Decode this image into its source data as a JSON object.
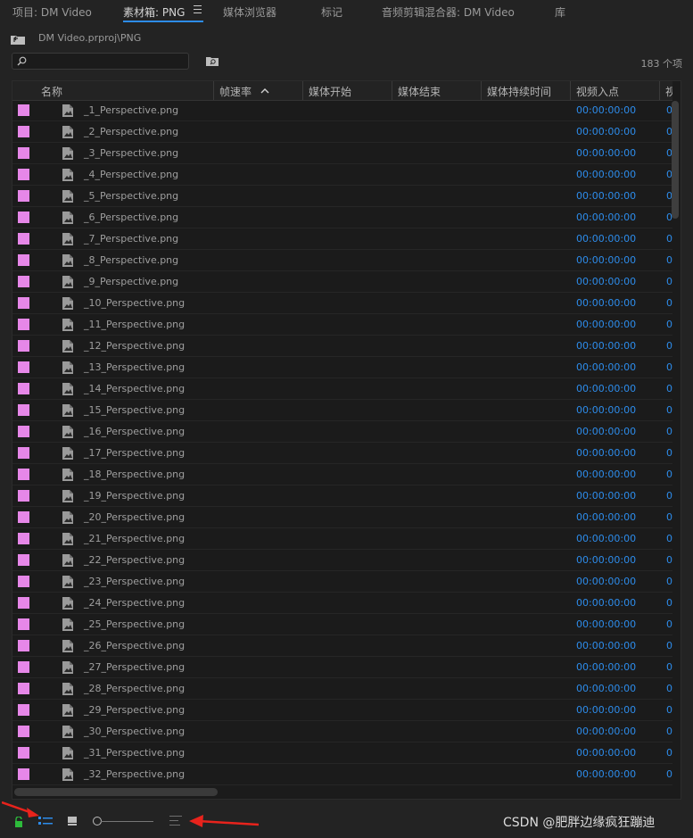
{
  "tabs": [
    {
      "label": "项目: DM Video"
    },
    {
      "label": "素材箱: PNG"
    },
    {
      "label": "媒体浏览器"
    },
    {
      "label": "标记"
    },
    {
      "label": "音频剪辑混合器: DM Video"
    },
    {
      "label": "库"
    }
  ],
  "path": "DM Video.prproj\\PNG",
  "search": {
    "placeholder": ""
  },
  "item_count": "183 个项",
  "columns": [
    "名称",
    "帧速率",
    "媒体开始",
    "媒体结束",
    "媒体持续时间",
    "视频入点",
    "视频"
  ],
  "label_color": "#e687e8",
  "accent_color": "#2d8ceb",
  "rows": [
    {
      "name": "_1_Perspective.png",
      "video_in": "00:00:00:00",
      "next_col": "0"
    },
    {
      "name": "_2_Perspective.png",
      "video_in": "00:00:00:00",
      "next_col": "0"
    },
    {
      "name": "_3_Perspective.png",
      "video_in": "00:00:00:00",
      "next_col": "0"
    },
    {
      "name": "_4_Perspective.png",
      "video_in": "00:00:00:00",
      "next_col": "0"
    },
    {
      "name": "_5_Perspective.png",
      "video_in": "00:00:00:00",
      "next_col": "0"
    },
    {
      "name": "_6_Perspective.png",
      "video_in": "00:00:00:00",
      "next_col": "0"
    },
    {
      "name": "_7_Perspective.png",
      "video_in": "00:00:00:00",
      "next_col": "0"
    },
    {
      "name": "_8_Perspective.png",
      "video_in": "00:00:00:00",
      "next_col": "0"
    },
    {
      "name": "_9_Perspective.png",
      "video_in": "00:00:00:00",
      "next_col": "0"
    },
    {
      "name": "_10_Perspective.png",
      "video_in": "00:00:00:00",
      "next_col": "0"
    },
    {
      "name": "_11_Perspective.png",
      "video_in": "00:00:00:00",
      "next_col": "0"
    },
    {
      "name": "_12_Perspective.png",
      "video_in": "00:00:00:00",
      "next_col": "0"
    },
    {
      "name": "_13_Perspective.png",
      "video_in": "00:00:00:00",
      "next_col": "0"
    },
    {
      "name": "_14_Perspective.png",
      "video_in": "00:00:00:00",
      "next_col": "0"
    },
    {
      "name": "_15_Perspective.png",
      "video_in": "00:00:00:00",
      "next_col": "0"
    },
    {
      "name": "_16_Perspective.png",
      "video_in": "00:00:00:00",
      "next_col": "0"
    },
    {
      "name": "_17_Perspective.png",
      "video_in": "00:00:00:00",
      "next_col": "0"
    },
    {
      "name": "_18_Perspective.png",
      "video_in": "00:00:00:00",
      "next_col": "0"
    },
    {
      "name": "_19_Perspective.png",
      "video_in": "00:00:00:00",
      "next_col": "0"
    },
    {
      "name": "_20_Perspective.png",
      "video_in": "00:00:00:00",
      "next_col": "0"
    },
    {
      "name": "_21_Perspective.png",
      "video_in": "00:00:00:00",
      "next_col": "0"
    },
    {
      "name": "_22_Perspective.png",
      "video_in": "00:00:00:00",
      "next_col": "0"
    },
    {
      "name": "_23_Perspective.png",
      "video_in": "00:00:00:00",
      "next_col": "0"
    },
    {
      "name": "_24_Perspective.png",
      "video_in": "00:00:00:00",
      "next_col": "0"
    },
    {
      "name": "_25_Perspective.png",
      "video_in": "00:00:00:00",
      "next_col": "0"
    },
    {
      "name": "_26_Perspective.png",
      "video_in": "00:00:00:00",
      "next_col": "0"
    },
    {
      "name": "_27_Perspective.png",
      "video_in": "00:00:00:00",
      "next_col": "0"
    },
    {
      "name": "_28_Perspective.png",
      "video_in": "00:00:00:00",
      "next_col": "0"
    },
    {
      "name": "_29_Perspective.png",
      "video_in": "00:00:00:00",
      "next_col": "0"
    },
    {
      "name": "_30_Perspective.png",
      "video_in": "00:00:00:00",
      "next_col": "0"
    },
    {
      "name": "_31_Perspective.png",
      "video_in": "00:00:00:00",
      "next_col": "0"
    },
    {
      "name": "_32_Perspective.png",
      "video_in": "00:00:00:00",
      "next_col": "0"
    }
  ],
  "bottom": {
    "icons": [
      "lock-icon",
      "list-view-icon",
      "icon-view-icon",
      "zoom-slider",
      "sort-icon"
    ]
  },
  "watermark": "CSDN @肥胖边缘疯狂蹦迪"
}
